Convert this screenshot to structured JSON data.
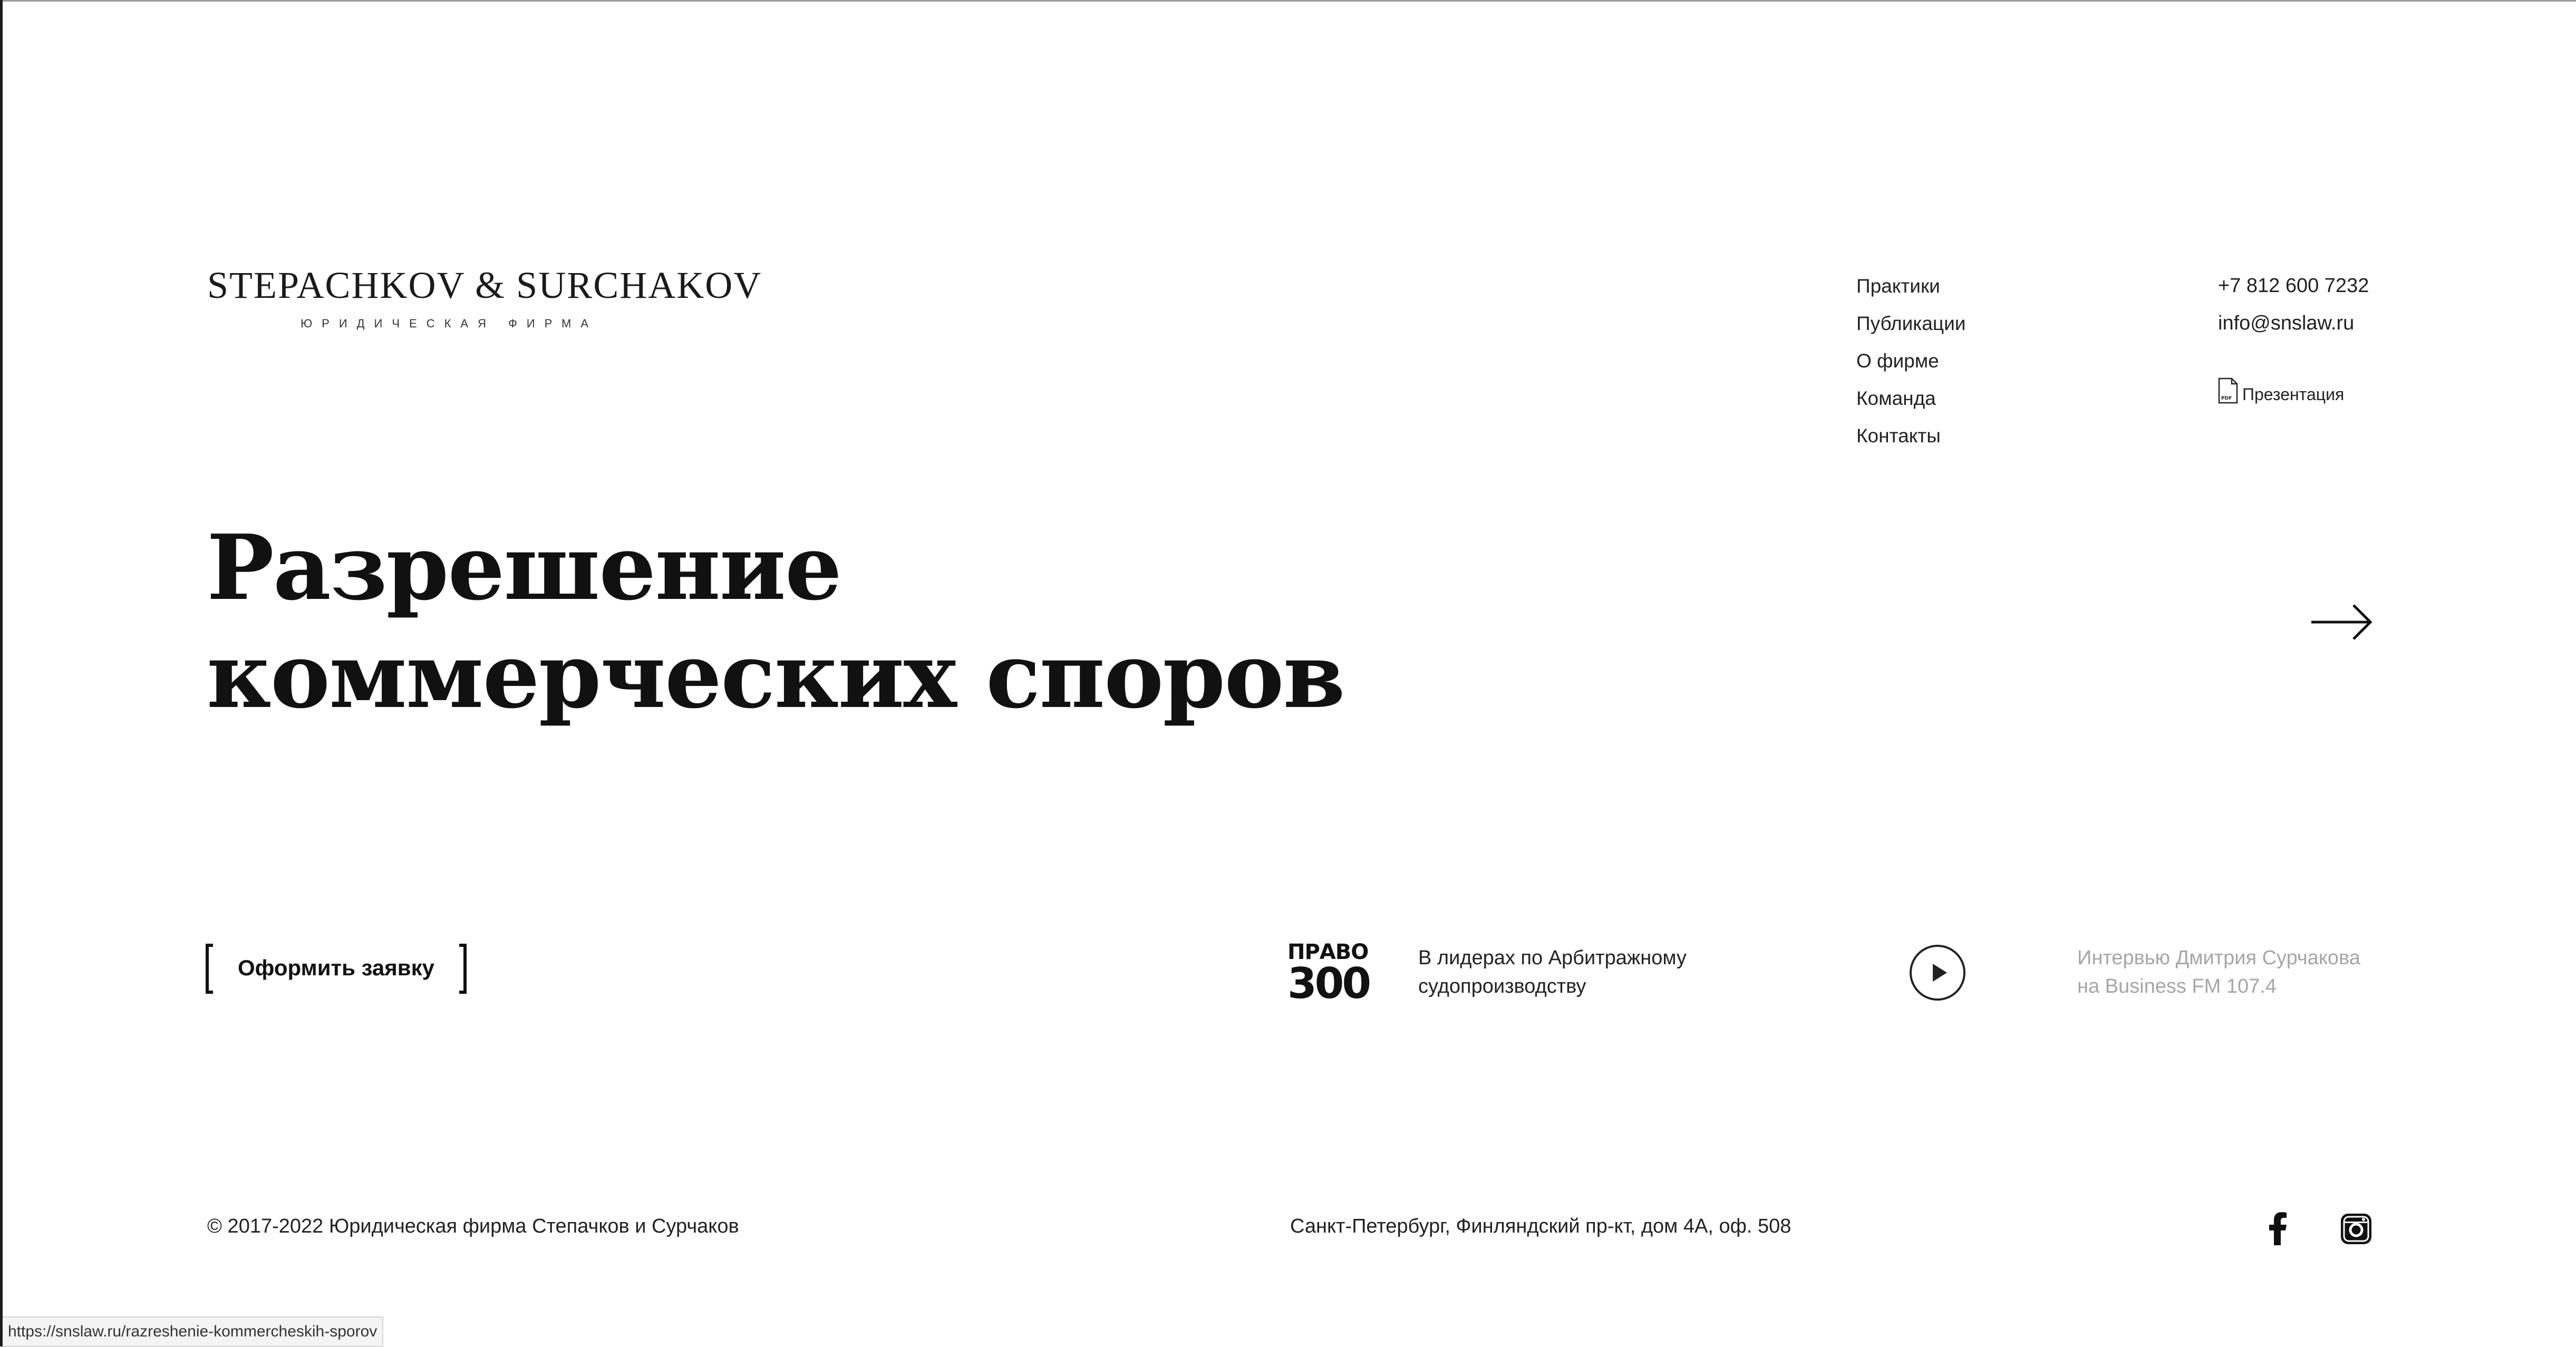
{
  "logo": {
    "name": "STEPACHKOV & SURCHAKOV",
    "subtitle": "ЮРИДИЧЕСКАЯ ФИРМА"
  },
  "nav": {
    "items": [
      {
        "label": "Практики"
      },
      {
        "label": "Публикации"
      },
      {
        "label": "О фирме"
      },
      {
        "label": "Команда"
      },
      {
        "label": "Контакты"
      }
    ]
  },
  "contacts": {
    "phone": "+7 812 600 7232",
    "email": "info@snslaw.ru",
    "presentation_label": "Презентация",
    "presentation_icon": "pdf-file-icon"
  },
  "hero": {
    "title_line1": "Разрешение",
    "title_line2": "коммерческих споров",
    "next_icon": "arrow-right-icon"
  },
  "cta": {
    "request_label": "Оформить заявку"
  },
  "award": {
    "logo_top": "ПРАВО",
    "logo_number": "300",
    "text_line1": "В лидерах по Арбитражному",
    "text_line2": "судопроизводству"
  },
  "interview": {
    "play_icon": "play-icon",
    "text_line1": "Интервью Дмитрия Сурчакова",
    "text_line2": "на Business FM 107.4"
  },
  "footer": {
    "copyright": "© 2017-2022 Юридическая фирма Степачков и Сурчаков",
    "address": "Санкт-Петербург, Финляндский пр-кт, дом 4А, оф. 508",
    "social": [
      {
        "icon": "facebook-icon"
      },
      {
        "icon": "instagram-icon"
      }
    ]
  },
  "status_bar": {
    "url": "https://snslaw.ru/razreshenie-kommercheskih-sporov"
  },
  "colors": {
    "text": "#111111",
    "muted": "#a6a6a6",
    "background": "#ffffff"
  }
}
